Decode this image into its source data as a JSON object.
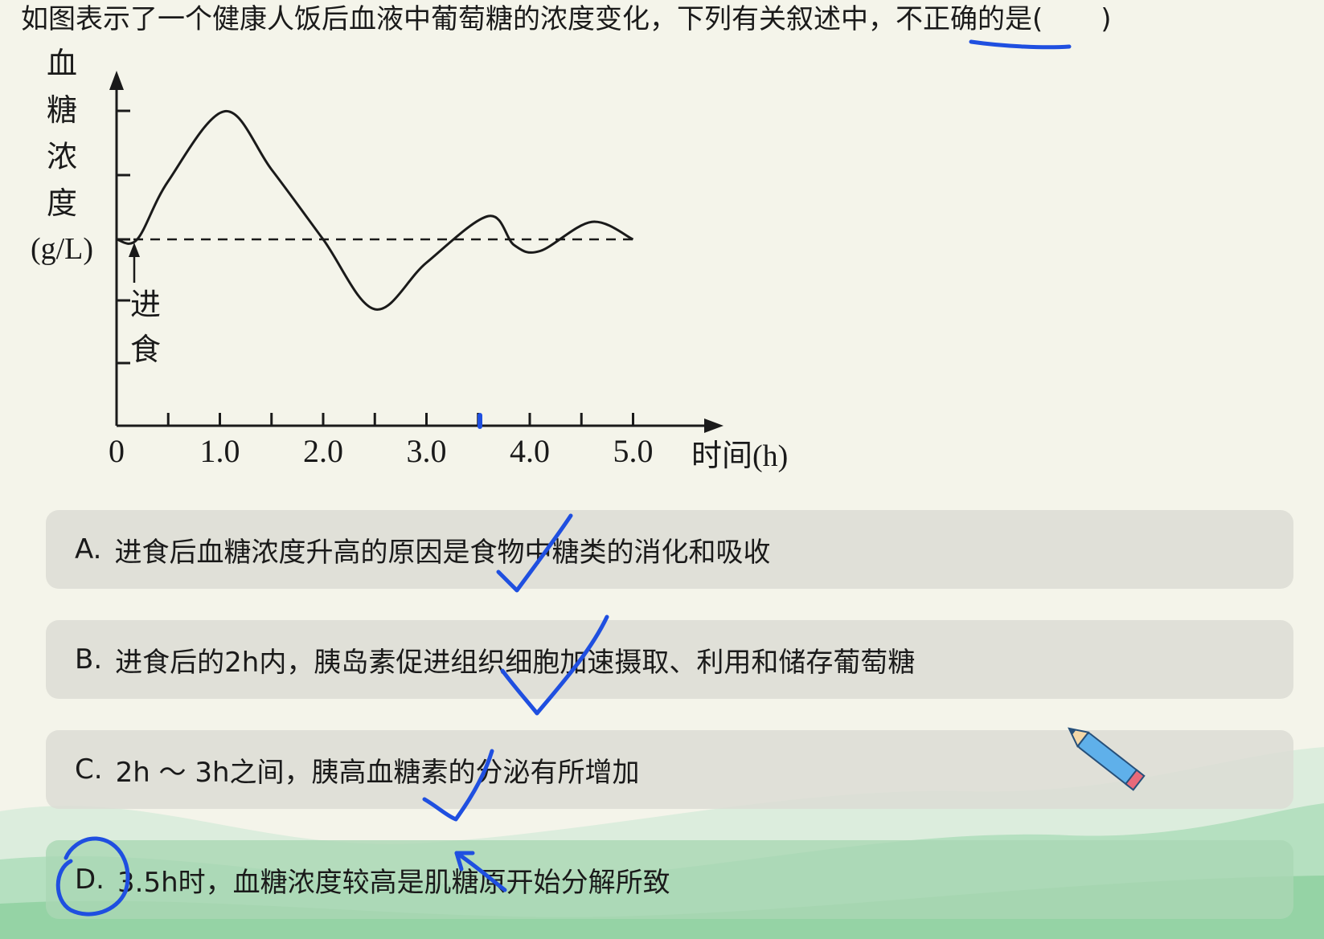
{
  "question": {
    "text": "如图表示了一个健康人饭后血液中葡萄糖的浓度变化，下列有关叙述中，",
    "highlight": "不正确的是",
    "paren_open": "(",
    "paren_close": ")"
  },
  "chart_data": {
    "type": "line",
    "ylabel_lines": [
      "血",
      "糖",
      "浓",
      "度",
      "(g/L)"
    ],
    "xlabel": "时间(h)",
    "x_ticks": [
      "0",
      "1.0",
      "2.0",
      "3.0",
      "4.0",
      "5.0"
    ],
    "annotation": "进食",
    "xlim": [
      0,
      5.0
    ],
    "baseline": "dashed",
    "series": [
      {
        "x": [
          0,
          0.2,
          0.5,
          1.05,
          1.5,
          2.0,
          2.5,
          3.0,
          3.6,
          3.85,
          4.1,
          4.6,
          5.0
        ],
        "y": [
          1.0,
          1.0,
          1.5,
          2.1,
          1.6,
          1.0,
          0.4,
          0.8,
          1.2,
          0.95,
          0.9,
          1.15,
          1.0
        ]
      }
    ]
  },
  "options": [
    {
      "letter": "A.",
      "text": "进食后血糖浓度升高的原因是食物中糖类的消化和吸收"
    },
    {
      "letter": "B.",
      "text": "进食后的2h内，胰岛素促进组织细胞加速摄取、利用和储存葡萄糖"
    },
    {
      "letter": "C.",
      "text": "2h ～ 3h之间，胰高血糖素的分泌有所增加"
    },
    {
      "letter": "D.",
      "text": "3.5h时，血糖浓度较高是肌糖原开始分解所致"
    }
  ],
  "colors": {
    "ink": "#1a1a1a",
    "annotation_blue": "#1f4fe0",
    "option_bg": "#dcdcd4",
    "wave_green": "#8fd0a0"
  },
  "icons": {
    "pencil": "pencil-icon"
  }
}
